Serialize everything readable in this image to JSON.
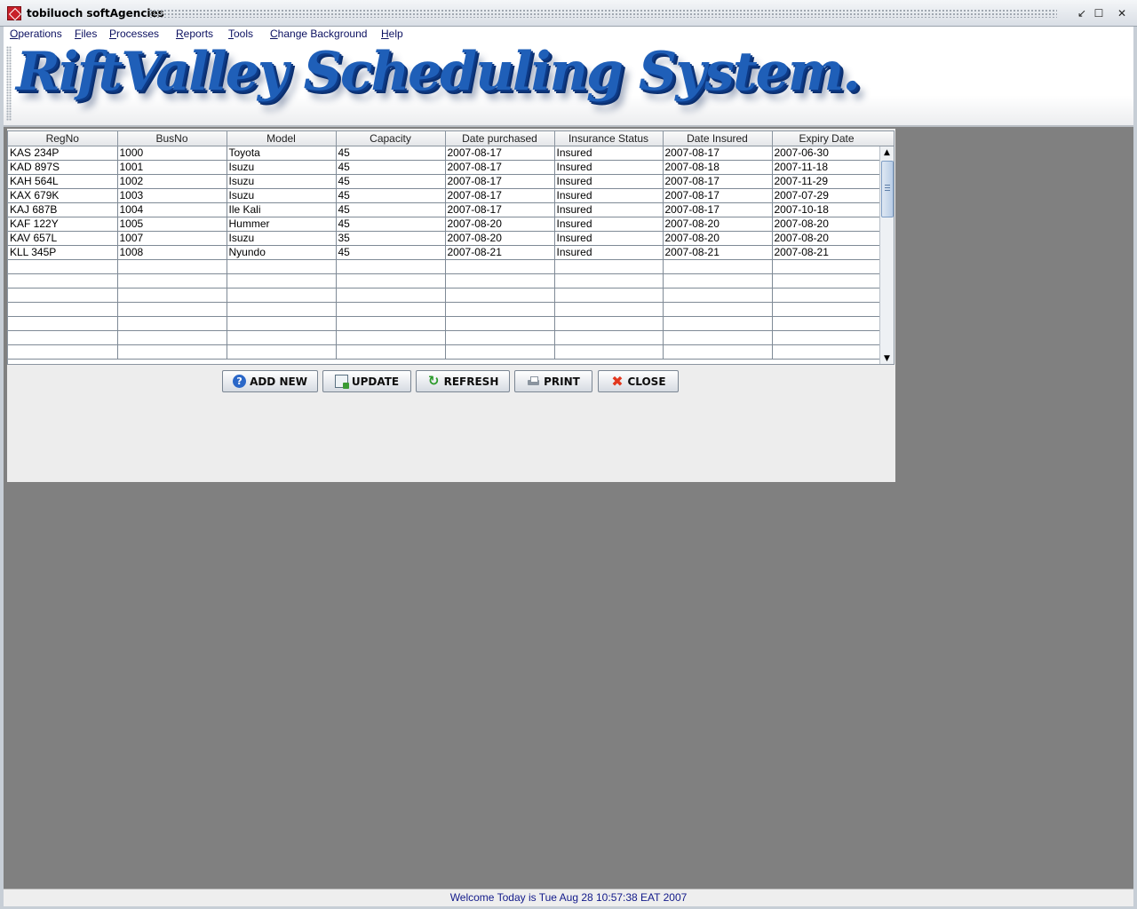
{
  "window": {
    "title": "tobiluoch softAgencies"
  },
  "menu": [
    {
      "mnemonic": "O",
      "rest": "perations"
    },
    {
      "mnemonic": "F",
      "rest": "iles"
    },
    {
      "mnemonic": "P",
      "rest": "rocesses"
    },
    {
      "mnemonic": "R",
      "rest": "eports"
    },
    {
      "mnemonic": "T",
      "rest": "ools"
    },
    {
      "mnemonic": "C",
      "rest": "hange Background"
    },
    {
      "mnemonic": "H",
      "rest": "elp"
    }
  ],
  "banner": {
    "text": "RiftValley Scheduling System."
  },
  "table": {
    "columns": [
      "RegNo",
      "BusNo",
      "Model",
      "Capacity",
      "Date purchased",
      "Insurance Status",
      "Date Insured",
      "Expiry Date"
    ],
    "rows": [
      [
        "KAS 234P",
        "1000",
        "Toyota",
        "45",
        "2007-08-17",
        "Insured",
        "2007-08-17",
        "2007-06-30"
      ],
      [
        "KAD 897S",
        "1001",
        "Isuzu",
        "45",
        "2007-08-17",
        "Insured",
        "2007-08-18",
        "2007-11-18"
      ],
      [
        "KAH 564L",
        "1002",
        "Isuzu",
        "45",
        "2007-08-17",
        "Insured",
        "2007-08-17",
        "2007-11-29"
      ],
      [
        "KAX 679K",
        "1003",
        "Isuzu",
        "45",
        "2007-08-17",
        "Insured",
        "2007-08-17",
        "2007-07-29"
      ],
      [
        "KAJ 687B",
        "1004",
        "Ile Kali",
        "45",
        "2007-08-17",
        "Insured",
        "2007-08-17",
        "2007-10-18"
      ],
      [
        "KAF 122Y",
        "1005",
        "Hummer",
        "45",
        "2007-08-20",
        "Insured",
        "2007-08-20",
        "2007-08-20"
      ],
      [
        "KAV 657L",
        "1007",
        "Isuzu",
        "35",
        "2007-08-20",
        "Insured",
        "2007-08-20",
        "2007-08-20"
      ],
      [
        "KLL 345P",
        "1008",
        "Nyundo",
        "45",
        "2007-08-21",
        "Insured",
        "2007-08-21",
        "2007-08-21"
      ]
    ],
    "empty_rows": 7
  },
  "buttons": {
    "add_new": "ADD NEW",
    "update": "UPDATE",
    "refresh": "REFRESH",
    "print": "PRINT",
    "close": "CLOSE"
  },
  "status": {
    "text": "Welcome Today is Tue Aug 28 10:57:38 EAT 2007"
  }
}
